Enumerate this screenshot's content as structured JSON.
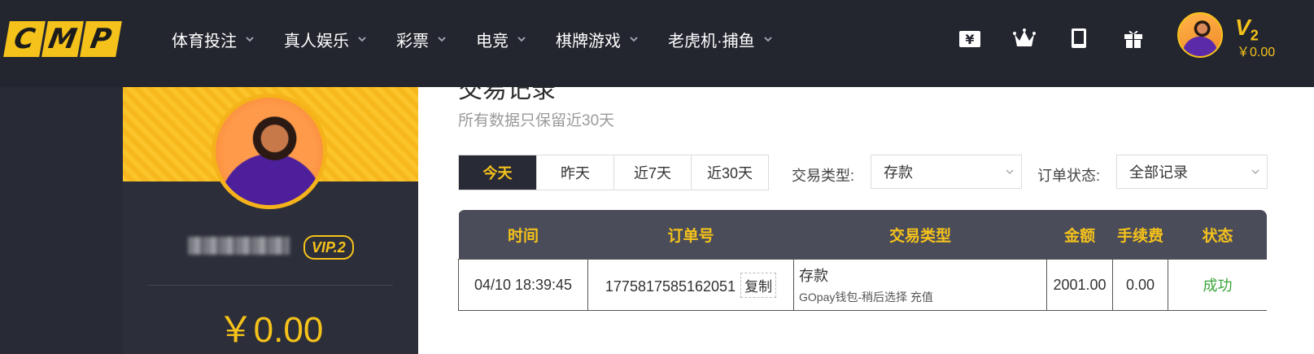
{
  "logo": {
    "letters": [
      "C",
      "M",
      "P"
    ]
  },
  "nav": {
    "items": [
      {
        "label": "体育投注"
      },
      {
        "label": "真人娱乐"
      },
      {
        "label": "彩票"
      },
      {
        "label": "电竞"
      },
      {
        "label": "棋牌游戏"
      },
      {
        "label": "老虎机·捕鱼"
      }
    ],
    "icons": [
      "yen-icon",
      "crown-icon",
      "tablet-icon",
      "gift-icon"
    ]
  },
  "user": {
    "vip_level": "V",
    "vip_num": "2",
    "balance_top": "￥0.00",
    "vip_badge": "VIP.2",
    "balance_big": "￥0.00"
  },
  "page": {
    "title": "交易记录",
    "subtitle": "所有数据只保留近30天"
  },
  "tabs": [
    {
      "label": "今天",
      "active": true
    },
    {
      "label": "昨天"
    },
    {
      "label": "近7天"
    },
    {
      "label": "近30天"
    }
  ],
  "filters": {
    "type_label": "交易类型:",
    "type_value": "存款",
    "status_label": "订单状态:",
    "status_value": "全部记录"
  },
  "table": {
    "headers": [
      "时间",
      "订单号",
      "交易类型",
      "金额",
      "手续费",
      "状态"
    ],
    "rows": [
      {
        "time": "04/10 18:39:45",
        "order_no": "1775817585162051",
        "copy_label": "复制",
        "type_main": "存款",
        "type_sub": "GOpay钱包-稍后选择 充值",
        "amount": "2001.00",
        "fee": "0.00",
        "status": "成功"
      }
    ]
  },
  "colors": {
    "accent": "#f5c21b",
    "dark": "#282a36",
    "success": "#3aa53a"
  }
}
